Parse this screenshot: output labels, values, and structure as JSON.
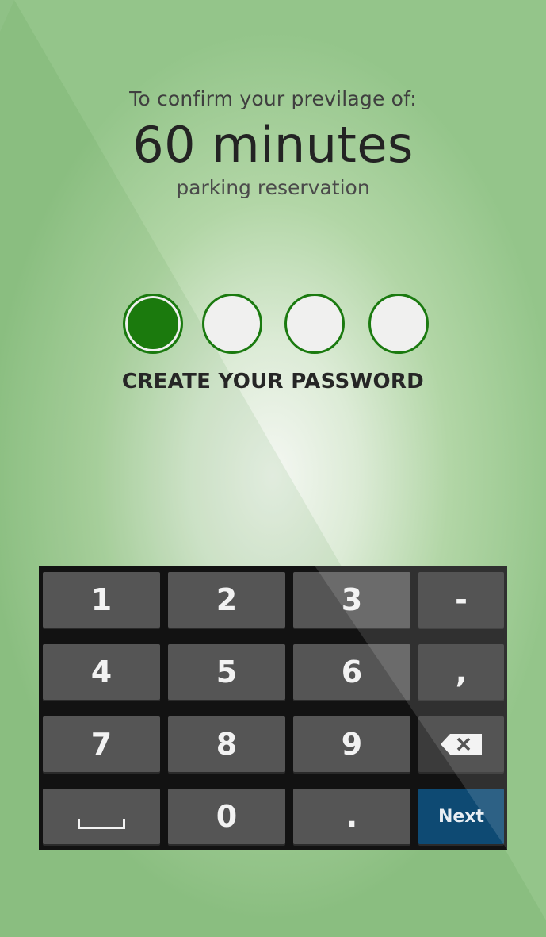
{
  "confirm": {
    "line1": "To confirm your previlage of:",
    "duration": "60 minutes",
    "line3": "parking reservation"
  },
  "pin": {
    "length": 4,
    "filled": 1,
    "label": "CREATE YOUR PASSWORD"
  },
  "keypad": {
    "rows": [
      [
        "1",
        "2",
        "3",
        "-"
      ],
      [
        "4",
        "5",
        "6",
        ","
      ],
      [
        "7",
        "8",
        "9",
        "backspace"
      ],
      [
        "space",
        "0",
        ".",
        "Next"
      ]
    ],
    "k1": "1",
    "k2": "2",
    "k3": "3",
    "dash": "-",
    "k4": "4",
    "k5": "5",
    "k6": "6",
    "comma": ",",
    "k7": "7",
    "k8": "8",
    "k9": "9",
    "k0": "0",
    "dot": ".",
    "next": "Next"
  },
  "colors": {
    "accent": "#1b7a0d",
    "next_key": "#0e4a73",
    "background": "#94c58a"
  }
}
